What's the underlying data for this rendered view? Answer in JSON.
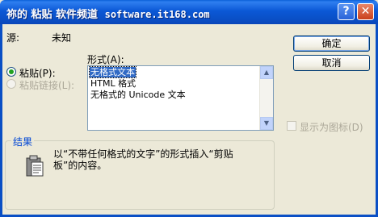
{
  "window": {
    "title": "祢的 粘贴 软件频道",
    "title_site": "software.it168.com",
    "help_glyph": "?",
    "close_glyph": "✕"
  },
  "source": {
    "label": "源:",
    "value": "未知"
  },
  "buttons": {
    "ok": "确定",
    "cancel": "取消"
  },
  "options": {
    "paste_label": "粘贴(P):",
    "paste_link_label": "粘贴链接(L):",
    "paste_checked": true,
    "paste_link_disabled": true
  },
  "format": {
    "label": "形式(A):",
    "items": [
      "无格式文本",
      "HTML 格式",
      "无格式的 Unicode 文本"
    ],
    "selected_index": 0
  },
  "display_as_icon": {
    "label": "显示为图标(D)",
    "checked": false,
    "disabled": true
  },
  "result": {
    "title": "结果",
    "text_line1": "以“不带任何格式的文字”的形式插入“剪贴",
    "text_line2": "板”的内容。"
  },
  "colors": {
    "title_bar": "#0a4fc5",
    "selection": "#316ac5",
    "group_title": "#0046d5",
    "dialog_bg": "#ece9d8"
  }
}
